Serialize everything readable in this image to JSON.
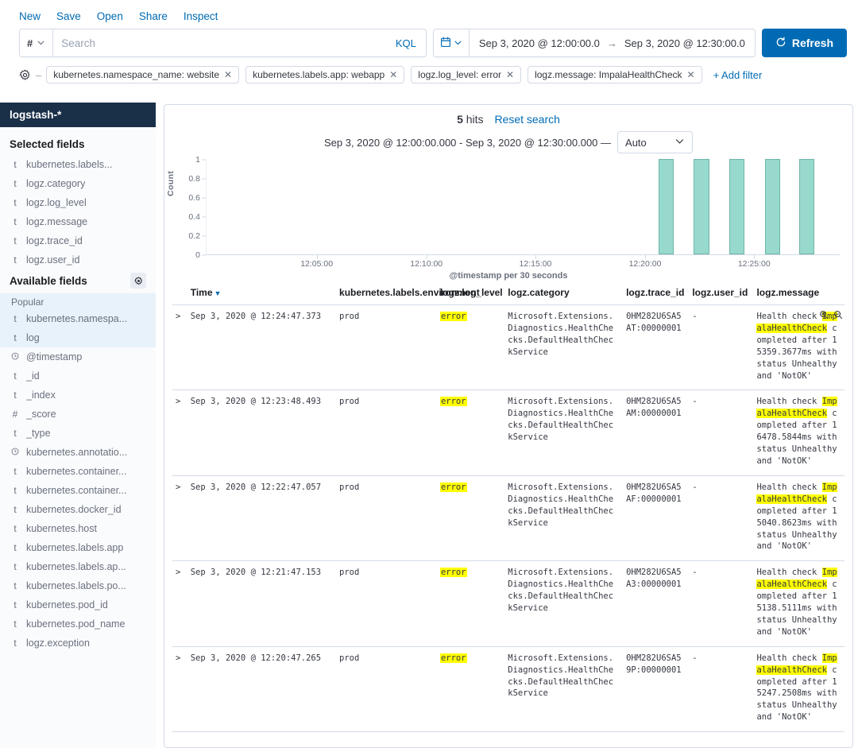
{
  "topmenu": {
    "items": [
      "New",
      "Save",
      "Open",
      "Share",
      "Inspect"
    ]
  },
  "query": {
    "dataset_prefix": "#",
    "placeholder": "Search",
    "value": "",
    "language_label": "KQL"
  },
  "daterange": {
    "start": "Sep 3, 2020 @ 12:00:00.0",
    "arrow": "→",
    "end": "Sep 3, 2020 @ 12:30:00.0",
    "refresh_label": "Refresh",
    "refresh_icon": "refresh-icon"
  },
  "filters": {
    "gear_icon": "filter-settings-gear-icon",
    "pills": [
      "kubernetes.namespace_name: website",
      "kubernetes.labels.app: webapp",
      "logz.log_level: error",
      "logz.message: ImpalaHealthCheck"
    ],
    "add_filter_label": "+ Add filter"
  },
  "sidebar": {
    "index_pattern": "logstash-*",
    "collapse_icon": "collapse-left-icon",
    "selected_fields_title": "Selected fields",
    "selected_fields": [
      {
        "type": "t",
        "name": "kubernetes.labels..."
      },
      {
        "type": "t",
        "name": "logz.category"
      },
      {
        "type": "t",
        "name": "logz.log_level"
      },
      {
        "type": "t",
        "name": "logz.message"
      },
      {
        "type": "t",
        "name": "logz.trace_id"
      },
      {
        "type": "t",
        "name": "logz.user_id"
      }
    ],
    "available_fields_title": "Available fields",
    "available_gear_icon": "field-settings-gear-icon",
    "popular_label": "Popular",
    "popular_fields": [
      {
        "type": "t",
        "name": "kubernetes.namespa..."
      },
      {
        "type": "t",
        "name": "log"
      }
    ],
    "available_fields": [
      {
        "type": "⓪",
        "name": "@timestamp"
      },
      {
        "type": "t",
        "name": "_id"
      },
      {
        "type": "t",
        "name": "_index"
      },
      {
        "type": "#",
        "name": "_score"
      },
      {
        "type": "t",
        "name": "_type"
      },
      {
        "type": "⓪",
        "name": "kubernetes.annotatio..."
      },
      {
        "type": "t",
        "name": "kubernetes.container..."
      },
      {
        "type": "t",
        "name": "kubernetes.container..."
      },
      {
        "type": "t",
        "name": "kubernetes.docker_id"
      },
      {
        "type": "t",
        "name": "kubernetes.host"
      },
      {
        "type": "t",
        "name": "kubernetes.labels.app"
      },
      {
        "type": "t",
        "name": "kubernetes.labels.ap..."
      },
      {
        "type": "t",
        "name": "kubernetes.labels.po..."
      },
      {
        "type": "t",
        "name": "kubernetes.pod_id"
      },
      {
        "type": "t",
        "name": "kubernetes.pod_name"
      },
      {
        "type": "t",
        "name": "logz.exception"
      }
    ]
  },
  "results": {
    "hit_count": "5",
    "hits_label": "hits",
    "reset_label": "Reset search",
    "range_text": "Sep 3, 2020 @ 12:00:00.000 - Sep 3, 2020 @ 12:30:00.000 —",
    "interval_value": "Auto",
    "interval_caret": "chevron-down-icon"
  },
  "chart_data": {
    "type": "bar",
    "title": "",
    "xlabel": "@timestamp per 30 seconds",
    "ylabel": "Count",
    "x_tick_labels": [
      "12:05:00",
      "12:10:00",
      "12:15:00",
      "12:20:00",
      "12:25:00"
    ],
    "x_tick_positions_pct": [
      17.5,
      34.8,
      52.0,
      69.3,
      86.5
    ],
    "y_tick_labels": [
      "0",
      "0.2",
      "0.4",
      "0.6",
      "0.8",
      "1"
    ],
    "ylim": [
      0,
      1
    ],
    "xlim": [
      "12:00:00",
      "12:30:00"
    ],
    "grid": false,
    "legend": "none",
    "bar_color": "#98d9cd",
    "bar_border_color": "#6eb5a7",
    "categories": [
      "12:20:30",
      "12:21:30",
      "12:22:30",
      "12:23:30",
      "12:24:30"
    ],
    "values": [
      1,
      1,
      1,
      1,
      1
    ],
    "bar_left_pct": [
      71.4,
      77.0,
      82.6,
      88.2,
      93.6
    ],
    "bar_width_pct": 2.4
  },
  "table": {
    "columns": [
      {
        "key": "time",
        "label": "Time",
        "sort": "desc",
        "row": "lower"
      },
      {
        "key": "env",
        "label": "kubernetes.labels.environment",
        "row": "upper"
      },
      {
        "key": "level",
        "label": "logz.log_level",
        "row": "upper"
      },
      {
        "key": "category",
        "label": "logz.category",
        "row": "lower"
      },
      {
        "key": "trace",
        "label": "logz.trace_id",
        "row": "upper"
      },
      {
        "key": "user",
        "label": "logz.user_id",
        "row": "upper"
      },
      {
        "key": "message",
        "label": "logz.message",
        "row": "lower"
      }
    ],
    "expand_icon": ">",
    "magnifier_plus_icon": "zoom-in-filter-for-value-icon",
    "magnifier_minus_icon": "zoom-out-filter-out-value-icon",
    "rows": [
      {
        "time": "Sep 3, 2020 @ 12:24:47.373",
        "env": "prod",
        "level": "error",
        "category": "Microsoft.Extensions.Diagnostics.HealthChecks.DefaultHealthCheckService",
        "trace": "0HM282U6SA5AT:00000001",
        "user": "-",
        "message_prefix": "Health check ",
        "message_highlight": "ImpalaHealthCheck",
        "message_suffix": " completed after 15359.3677ms with status Unhealthy and 'NotOK'",
        "show_magnifiers": true
      },
      {
        "time": "Sep 3, 2020 @ 12:23:48.493",
        "env": "prod",
        "level": "error",
        "category": "Microsoft.Extensions.Diagnostics.HealthChecks.DefaultHealthCheckService",
        "trace": "0HM282U6SA5AM:00000001",
        "user": "-",
        "message_prefix": "Health check ",
        "message_highlight": "ImpalaHealthCheck",
        "message_suffix": " completed after 16478.5844ms with status Unhealthy and 'NotOK'",
        "show_magnifiers": false
      },
      {
        "time": "Sep 3, 2020 @ 12:22:47.057",
        "env": "prod",
        "level": "error",
        "category": "Microsoft.Extensions.Diagnostics.HealthChecks.DefaultHealthCheckService",
        "trace": "0HM282U6SA5AF:00000001",
        "user": "-",
        "message_prefix": "Health check ",
        "message_highlight": "ImpalaHealthCheck",
        "message_suffix": " completed after 15040.8623ms with status Unhealthy and 'NotOK'",
        "show_magnifiers": false
      },
      {
        "time": "Sep 3, 2020 @ 12:21:47.153",
        "env": "prod",
        "level": "error",
        "category": "Microsoft.Extensions.Diagnostics.HealthChecks.DefaultHealthCheckService",
        "trace": "0HM282U6SA5A3:00000001",
        "user": "-",
        "message_prefix": "Health check ",
        "message_highlight": "ImpalaHealthCheck",
        "message_suffix": " completed after 15138.5111ms with status Unhealthy and 'NotOK'",
        "show_magnifiers": false
      },
      {
        "time": "Sep 3, 2020 @ 12:20:47.265",
        "env": "prod",
        "level": "error",
        "category": "Microsoft.Extensions.Diagnostics.HealthChecks.DefaultHealthCheckService",
        "trace": "0HM282U6SA59P:00000001",
        "user": "-",
        "message_prefix": "Health check ",
        "message_highlight": "ImpalaHealthCheck",
        "message_suffix": " completed after 15247.2508ms with status Unhealthy and 'NotOK'",
        "show_magnifiers": false
      }
    ]
  },
  "colors": {
    "accent": "#006bb4",
    "index_pattern_bg": "#1a3049",
    "highlight": "#ffff00",
    "bar": "#98d9cd"
  }
}
